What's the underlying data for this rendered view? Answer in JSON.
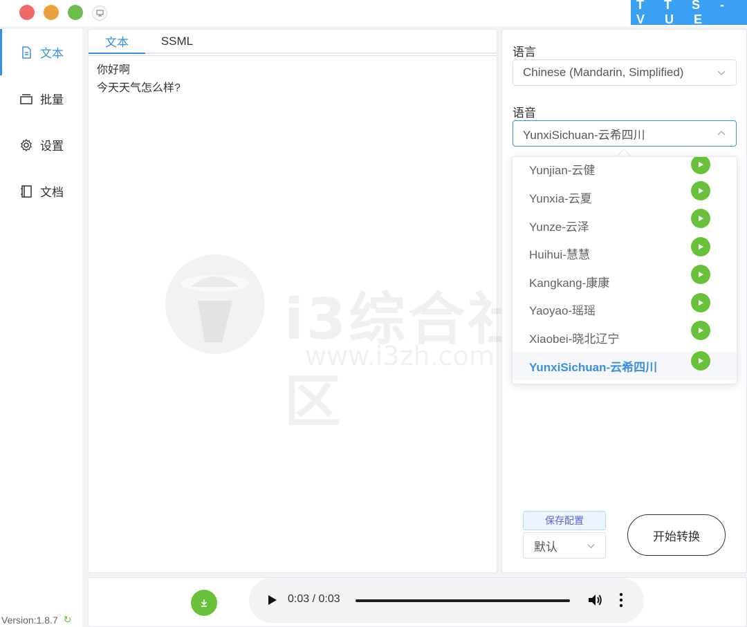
{
  "window": {
    "brand": "T T S - V U E"
  },
  "sidebar": {
    "items": [
      {
        "label": "文本",
        "icon": "document-icon"
      },
      {
        "label": "批量",
        "icon": "layers-icon"
      },
      {
        "label": "设置",
        "icon": "gear-icon"
      },
      {
        "label": "文档",
        "icon": "book-icon"
      }
    ],
    "version": "Version:1.8.7"
  },
  "editor": {
    "tabs": [
      "文本",
      "SSML"
    ],
    "active_tab": "文本",
    "lines": [
      "你好啊",
      "今天天气怎么样?"
    ]
  },
  "watermark": {
    "text": "i3综合社区",
    "url": "www.i3zh.com"
  },
  "settings": {
    "language_label": "语言",
    "language_value": "Chinese (Mandarin, Simplified)",
    "voice_label": "语音",
    "voice_value": "YunxiSichuan-云希四川",
    "voice_options": [
      "Yunjian-云健",
      "Yunxia-云夏",
      "Yunze-云泽",
      "Huihui-慧慧",
      "Kangkang-康康",
      "Yaoyao-瑶瑶",
      "Xiaobei-晓北辽宁",
      "YunxiSichuan-云希四川"
    ],
    "selected_voice_index": 7,
    "save_config_label": "保存配置",
    "config_value": "默认",
    "start_button": "开始转换"
  },
  "player": {
    "time": "0:03 / 0:03",
    "progress": 1.0
  },
  "colors": {
    "accent": "#3a8ee6",
    "brand": "#3aa0f3",
    "green": "#67c23a"
  }
}
